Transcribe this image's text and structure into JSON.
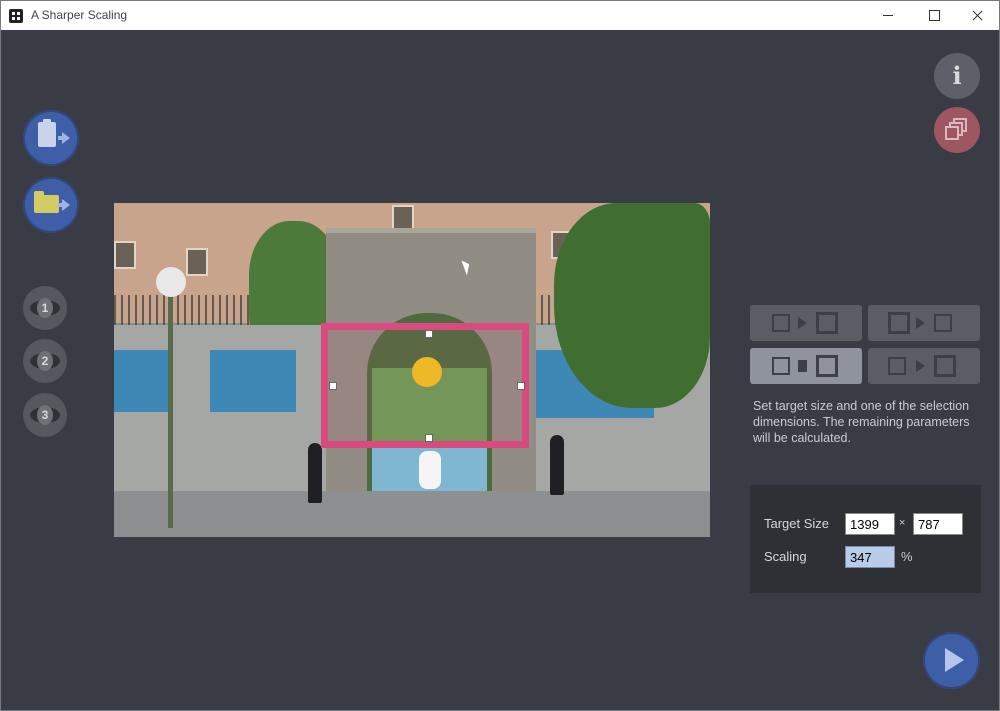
{
  "window": {
    "title": "A Sharper Scaling"
  },
  "toolbar": {
    "paste_icon": "clipboard-paste-icon",
    "open_icon": "folder-open-icon",
    "presets": [
      "1",
      "2",
      "3"
    ],
    "info_icon": "info-icon",
    "batch_icon": "stacked-layers-icon"
  },
  "mode_buttons": [
    {
      "icon": "scale-source-to-target-icon",
      "active": false
    },
    {
      "icon": "scale-target-from-source-icon",
      "active": false
    },
    {
      "icon": "vertical-fit-icon",
      "active": true
    },
    {
      "icon": "horizontal-fit-icon",
      "active": false
    }
  ],
  "hint": "Set target size and one of the selection dimensions. The remaining parameters will be calculated.",
  "settings": {
    "target_size_label": "Target Size",
    "width": "1399",
    "times": "×",
    "height": "787",
    "scaling_label": "Scaling",
    "scaling": "347",
    "percent": "%"
  },
  "colors": {
    "background": "#393c44",
    "accent_blue": "#3e5fa8",
    "selection": "#d94a7f",
    "panel": "#2e3036"
  }
}
